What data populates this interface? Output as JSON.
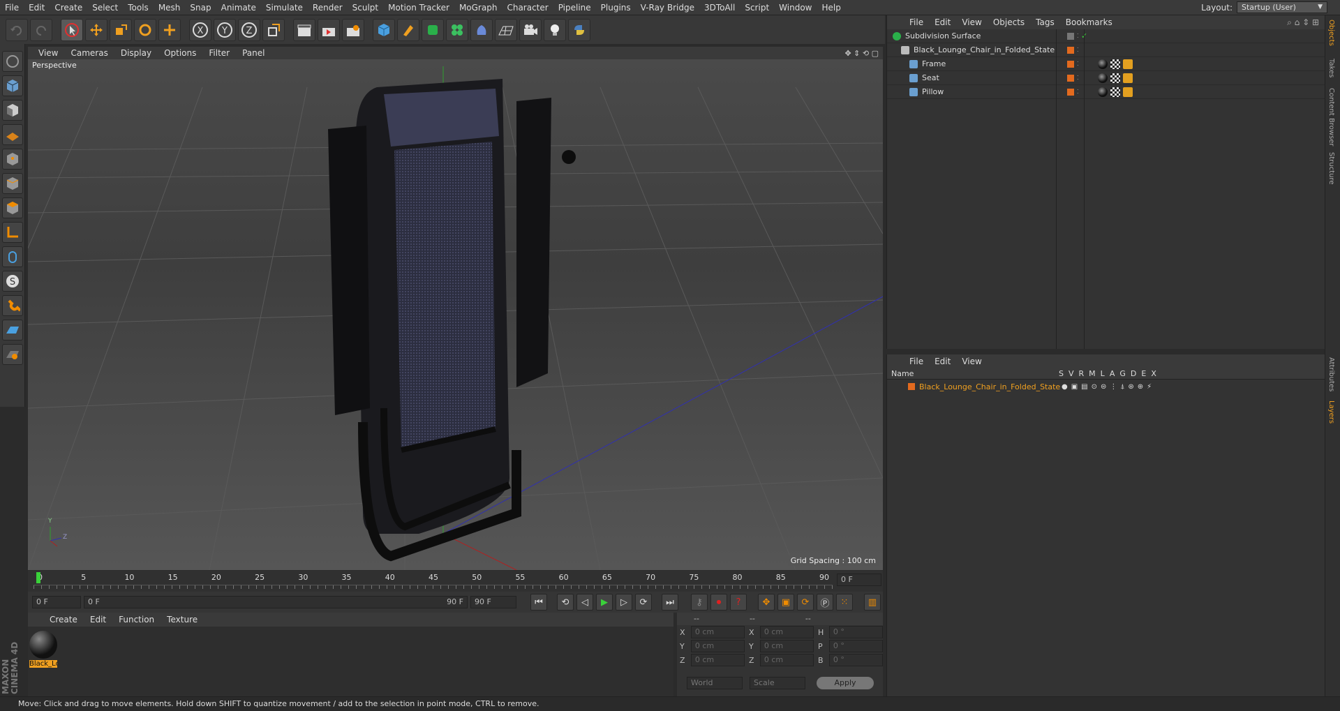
{
  "menu": [
    "File",
    "Edit",
    "Create",
    "Select",
    "Tools",
    "Mesh",
    "Snap",
    "Animate",
    "Simulate",
    "Render",
    "Sculpt",
    "Motion Tracker",
    "MoGraph",
    "Character",
    "Pipeline",
    "Plugins",
    "V-Ray Bridge",
    "3DToAll",
    "Script",
    "Window",
    "Help"
  ],
  "layout": {
    "label": "Layout:",
    "value": "Startup (User)"
  },
  "viewport": {
    "menu": [
      "View",
      "Cameras",
      "Display",
      "Options",
      "Filter",
      "Panel"
    ],
    "camera_label": "Perspective",
    "grid_spacing": "Grid Spacing : 100 cm",
    "axis": {
      "y": "Y",
      "x": "X",
      "z": "Z"
    }
  },
  "timeline": {
    "ticks": [
      "0",
      "5",
      "10",
      "15",
      "20",
      "25",
      "30",
      "35",
      "40",
      "45",
      "50",
      "55",
      "60",
      "65",
      "70",
      "75",
      "80",
      "85",
      "90"
    ],
    "current_frame_field": "0 F",
    "start_field": "0 F",
    "range_start": "0 F",
    "range_end": "90 F",
    "end_field": "90 F"
  },
  "materials": {
    "menu": [
      "Create",
      "Edit",
      "Function",
      "Texture"
    ],
    "items": [
      {
        "label": "Black_Lc"
      }
    ]
  },
  "coords": {
    "header": [
      "--",
      "--",
      "--"
    ],
    "rows": [
      {
        "a": "X",
        "av": "0 cm",
        "b": "X",
        "bv": "0 cm",
        "c": "H",
        "cv": "0 °"
      },
      {
        "a": "Y",
        "av": "0 cm",
        "b": "Y",
        "bv": "0 cm",
        "c": "P",
        "cv": "0 °"
      },
      {
        "a": "Z",
        "av": "0 cm",
        "b": "Z",
        "bv": "0 cm",
        "c": "B",
        "cv": "0 °"
      }
    ],
    "mode1": "World",
    "mode2": "Scale",
    "apply": "Apply"
  },
  "objects_panel": {
    "menu": [
      "File",
      "Edit",
      "View",
      "Objects",
      "Tags",
      "Bookmarks"
    ],
    "tree": [
      {
        "name": "Subdivision Surface",
        "level": 0
      },
      {
        "name": "Black_Lounge_Chair_in_Folded_State",
        "level": 1
      },
      {
        "name": "Frame",
        "level": 2
      },
      {
        "name": "Seat",
        "level": 2
      },
      {
        "name": "Pillow",
        "level": 2
      }
    ]
  },
  "layers_panel": {
    "menu": [
      "File",
      "Edit",
      "View"
    ],
    "columns": {
      "name": "Name",
      "flags": [
        "S",
        "V",
        "R",
        "M",
        "L",
        "A",
        "G",
        "D",
        "E",
        "X"
      ]
    },
    "rows": [
      {
        "name": "Black_Lounge_Chair_in_Folded_State"
      }
    ]
  },
  "right_tabs": [
    "Objects",
    "Takes",
    "Content Browser",
    "Structure",
    "Attributes",
    "Layers"
  ],
  "brand": "MAXON CINEMA 4D",
  "status": "Move: Click and drag to move elements. Hold down SHIFT to quantize movement / add to the selection in point mode, CTRL to remove.",
  "colors": {
    "accent": "#f08c00",
    "layer_orange": "#e36a1e",
    "select_orange": "#f0a020"
  }
}
